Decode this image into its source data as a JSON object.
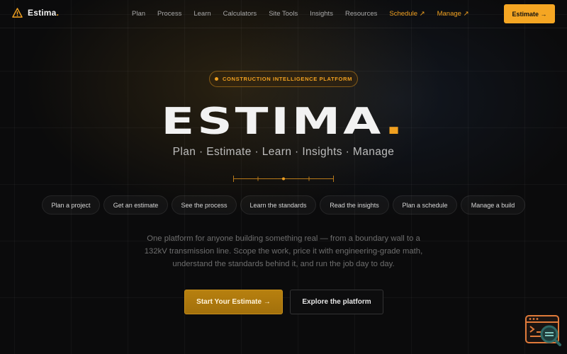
{
  "brand": {
    "name": "Estima",
    "dot": "."
  },
  "nav": {
    "links": [
      "Plan",
      "Process",
      "Learn",
      "Calculators",
      "Site Tools",
      "Insights",
      "Resources"
    ],
    "accent_links": [
      "Schedule ↗",
      "Manage ↗"
    ],
    "cta": "Estimate →"
  },
  "hero": {
    "badge": "CONSTRUCTION INTELLIGENCE PLATFORM",
    "title": "ESTIMA",
    "title_dot": ".",
    "subtitle": "Plan · Estimate · Learn · Insights · Manage",
    "chips": [
      "Plan a project",
      "Get an estimate",
      "See the process",
      "Learn the standards",
      "Read the insights",
      "Plan a schedule",
      "Manage a build"
    ],
    "description": "One platform for anyone building something real — from a boundary wall to a 132kV transmission line. Scope the work, price it with engineering-grade math, understand the standards behind it, and run the job day to day.",
    "primary_button": "Start Your Estimate →",
    "secondary_button": "Explore the platform"
  },
  "colors": {
    "accent": "#f5a623",
    "background": "#0b0b0c",
    "text": "#f2f2f2"
  },
  "icons": {
    "logo": "warning-triangle-icon",
    "widget": "terminal-search-icon"
  }
}
